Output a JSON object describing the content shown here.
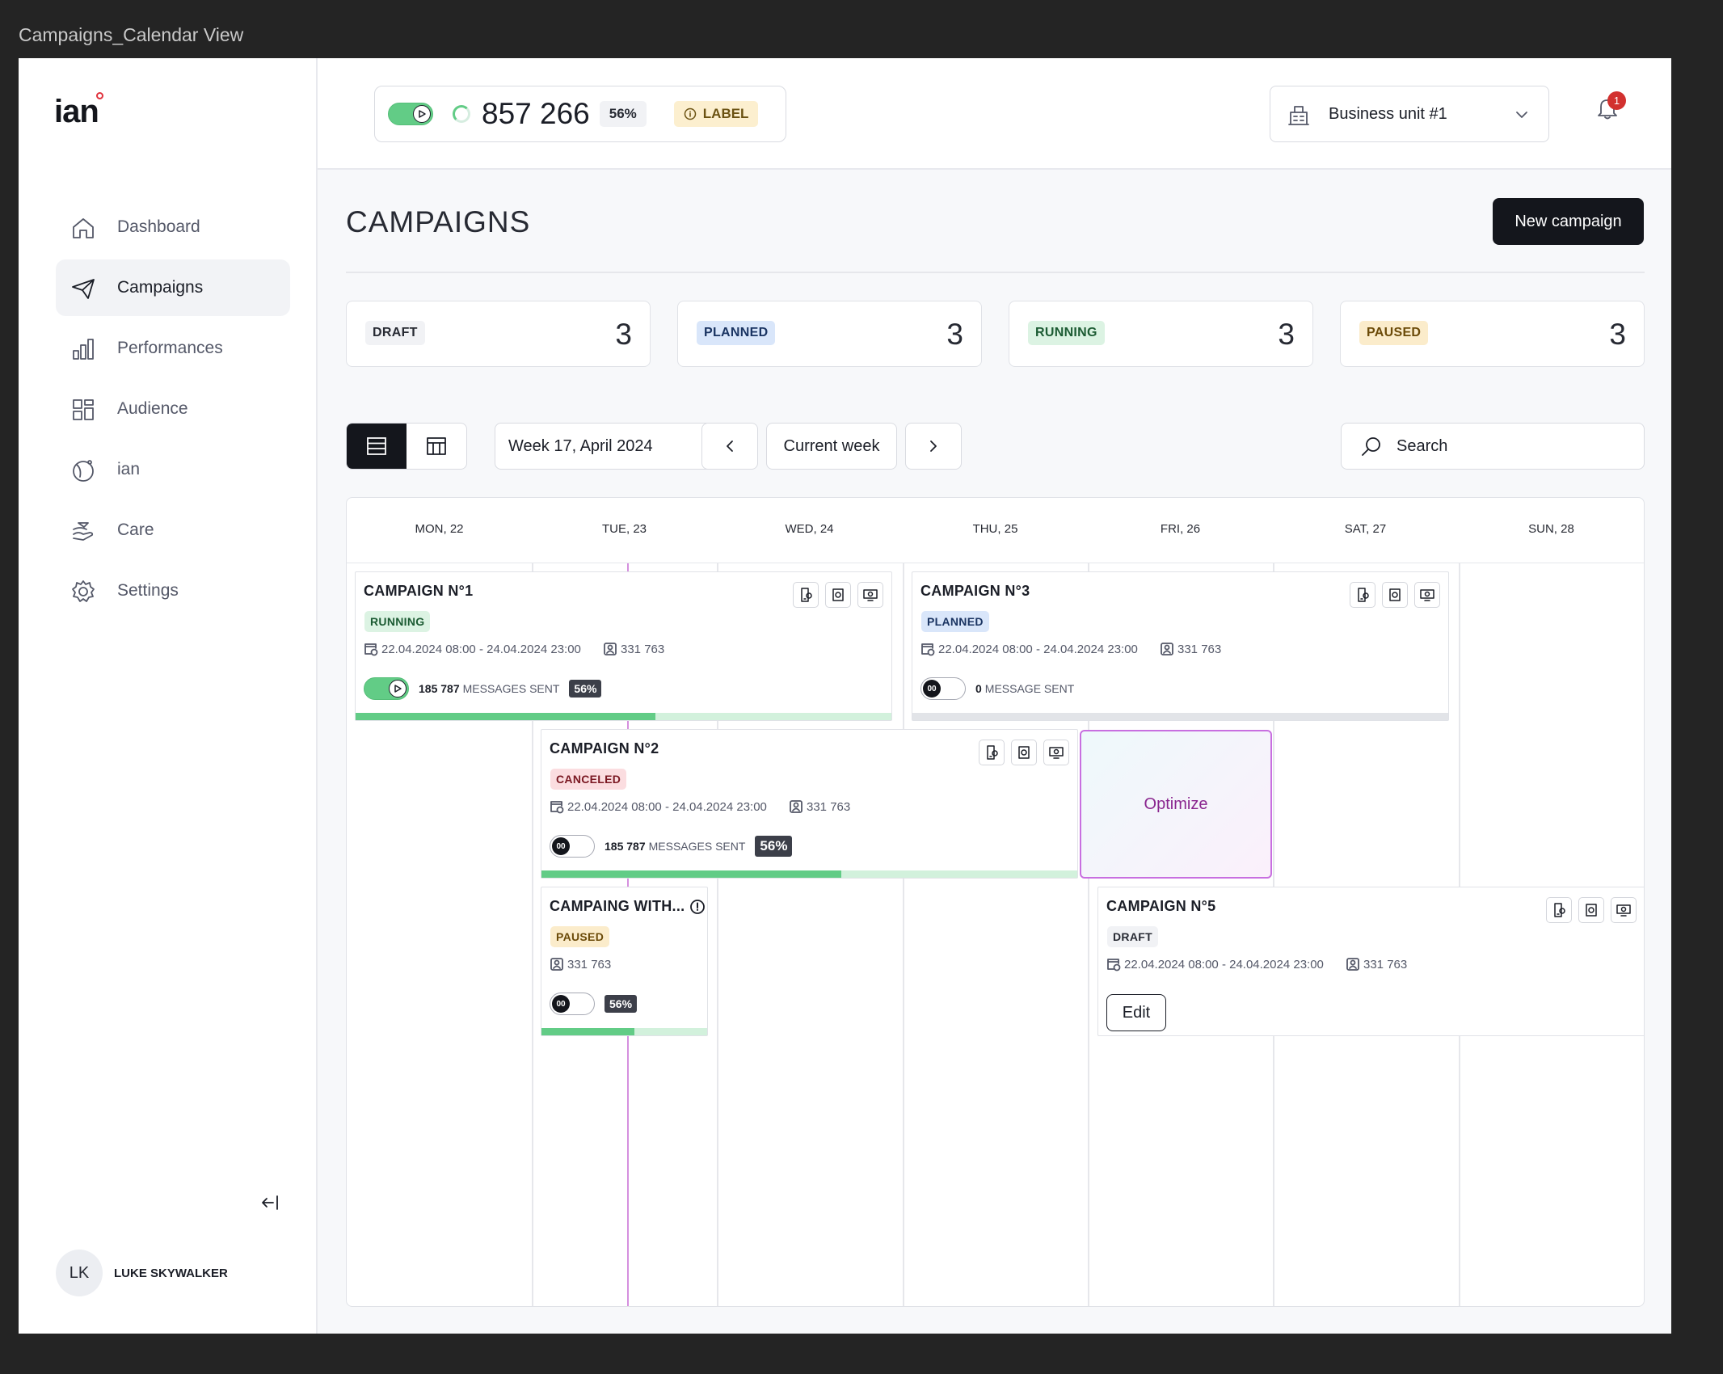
{
  "frame": {
    "title": "Campaigns_Calendar View"
  },
  "sidebar": {
    "logo": "ian",
    "items": [
      {
        "label": "Dashboard",
        "icon": "home-icon"
      },
      {
        "label": "Campaigns",
        "icon": "send-icon",
        "active": true
      },
      {
        "label": "Performances",
        "icon": "bar-chart-icon"
      },
      {
        "label": "Audience",
        "icon": "grid-icon"
      },
      {
        "label": "ian",
        "icon": "ian-icon"
      },
      {
        "label": "Care",
        "icon": "care-icon"
      },
      {
        "label": "Settings",
        "icon": "gear-icon"
      }
    ],
    "user": {
      "initials": "LK",
      "name": "LUKE SKYWALKER"
    }
  },
  "topbar": {
    "metric_value": "857 266",
    "metric_pct": "56%",
    "label": "LABEL",
    "business_unit": "Business unit #1",
    "notifications": "1"
  },
  "main": {
    "title": "CAMPAIGNS",
    "new_campaign": "New campaign",
    "stats": [
      {
        "label": "DRAFT",
        "count": "3",
        "status": "draft"
      },
      {
        "label": "PLANNED",
        "count": "3",
        "status": "planned"
      },
      {
        "label": "RUNNING",
        "count": "3",
        "status": "running"
      },
      {
        "label": "PAUSED",
        "count": "3",
        "status": "paused"
      }
    ],
    "week": "Week 17, April 2024",
    "current_week": "Current week",
    "search_placeholder": "Search"
  },
  "calendar": {
    "days": [
      "MON, 22",
      "TUE, 23",
      "WED, 24",
      "THU, 25",
      "FRI, 26",
      "SAT, 27",
      "SUN, 28"
    ],
    "campaigns": [
      {
        "title": "CAMPAIGN N°1",
        "status": "RUNNING",
        "dates": "22.04.2024 08:00 - 24.04.2024 23:00",
        "audience": "331 763",
        "sent_count": "185 787",
        "sent_label": "MESSAGES SENT",
        "pct": "56%",
        "progress": 0.56
      },
      {
        "title": "CAMPAIGN N°3",
        "status": "PLANNED",
        "dates": "22.04.2024 08:00 - 24.04.2024 23:00",
        "audience": "331 763",
        "sent_count": "0",
        "sent_label": "MESSAGE SENT",
        "progress": 0
      },
      {
        "title": "CAMPAIGN N°2",
        "status": "CANCELED",
        "dates": "22.04.2024 08:00 - 24.04.2024 23:00",
        "audience": "331 763",
        "sent_count": "185 787",
        "sent_label": "MESSAGES SENT",
        "pct": "56%",
        "progress": 0.56
      },
      {
        "title": "CAMPAING WITH...",
        "status": "PAUSED",
        "audience": "331 763",
        "pct": "56%",
        "progress": 0.56
      },
      {
        "title": "CAMPAIGN N°5",
        "status": "DRAFT",
        "dates": "22.04.2024 08:00 - 24.04.2024 23:00",
        "audience": "331 763",
        "edit": "Edit"
      }
    ],
    "optimize": "Optimize",
    "toggle_off_text": "00"
  },
  "colors": {
    "accent_dark": "#14161c",
    "running": "#62cc86",
    "today_line": "#d590df",
    "notification": "#d2312f"
  }
}
